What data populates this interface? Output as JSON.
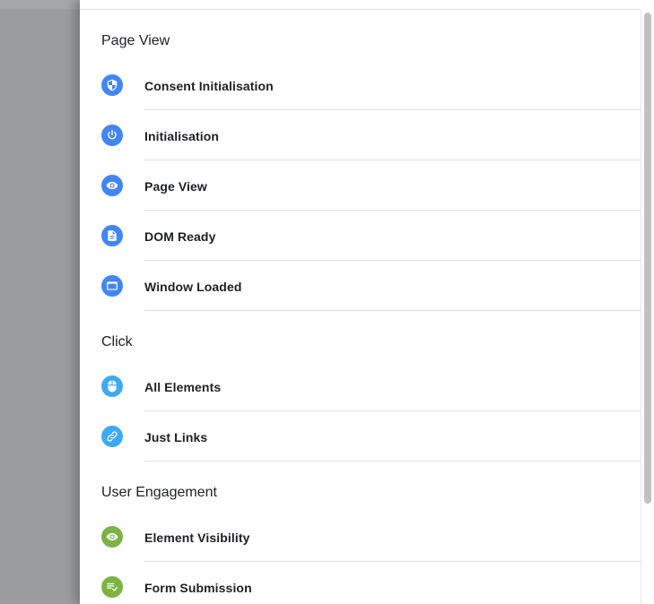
{
  "colors": {
    "page_view_icon": "#4285f4",
    "click_icon": "#3fa9f5",
    "engagement_icon": "#7cb342"
  },
  "sections": [
    {
      "title": "Page View",
      "items": [
        {
          "label": "Consent Initialisation",
          "icon": "shield-icon"
        },
        {
          "label": "Initialisation",
          "icon": "power-icon"
        },
        {
          "label": "Page View",
          "icon": "eye-icon"
        },
        {
          "label": "DOM Ready",
          "icon": "document-icon"
        },
        {
          "label": "Window Loaded",
          "icon": "window-icon"
        }
      ]
    },
    {
      "title": "Click",
      "items": [
        {
          "label": "All Elements",
          "icon": "mouse-icon"
        },
        {
          "label": "Just Links",
          "icon": "link-icon"
        }
      ]
    },
    {
      "title": "User Engagement",
      "items": [
        {
          "label": "Element Visibility",
          "icon": "eye-icon"
        },
        {
          "label": "Form Submission",
          "icon": "form-icon"
        }
      ]
    }
  ]
}
